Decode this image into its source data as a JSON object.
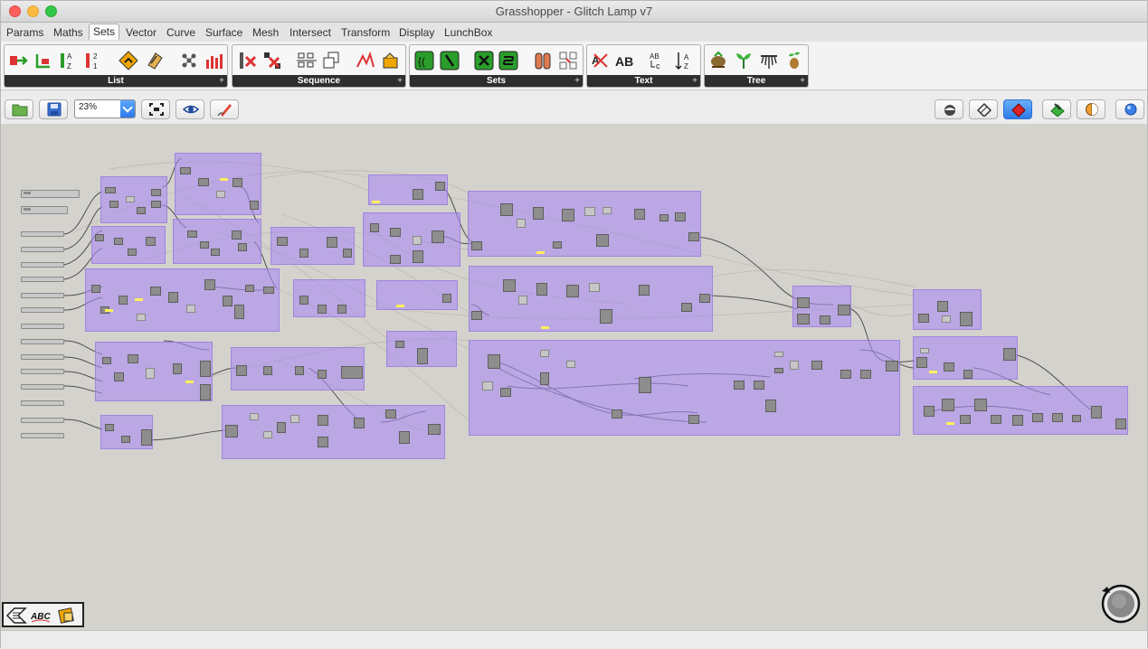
{
  "window": {
    "title": "Grasshopper - Glitch Lamp v7"
  },
  "tabs": [
    {
      "label": "Params",
      "active": false
    },
    {
      "label": "Maths",
      "active": false
    },
    {
      "label": "Sets",
      "active": true
    },
    {
      "label": "Vector",
      "active": false
    },
    {
      "label": "Curve",
      "active": false
    },
    {
      "label": "Surface",
      "active": false
    },
    {
      "label": "Mesh",
      "active": false
    },
    {
      "label": "Intersect",
      "active": false
    },
    {
      "label": "Transform",
      "active": false
    },
    {
      "label": "Display",
      "active": false
    },
    {
      "label": "LunchBox",
      "active": false
    }
  ],
  "ribbon": {
    "groups": [
      {
        "label": "List",
        "icons": [
          "list-item-icon",
          "list-length-icon",
          "sort-list-icon",
          "reverse-list-icon",
          "shift-list-icon",
          "split-list-icon",
          "weave-icon",
          "partition-icon"
        ]
      },
      {
        "label": "Sequence",
        "icons": [
          "cull-index-icon",
          "cull-pattern-icon",
          "series-icon",
          "duplicate-icon",
          "random-icon",
          "jitter-icon"
        ]
      },
      {
        "label": "Sets",
        "icons": [
          "set-union-icon",
          "set-difference-icon",
          "set-intersection-icon",
          "set-majority-icon",
          "member-index-icon",
          "combinations-icon"
        ]
      },
      {
        "label": "Text",
        "icons": [
          "text-split-icon",
          "concatenate-icon",
          "text-case-icon",
          "sort-text-icon"
        ]
      },
      {
        "label": "Tree",
        "icons": [
          "flatten-tree-icon",
          "graft-tree-icon",
          "explode-tree-icon",
          "simplify-tree-icon"
        ]
      }
    ]
  },
  "toolbar": {
    "zoom": "23%"
  },
  "colors": {
    "group_fill": "#aa8cf0",
    "canvas": "#d4d2cc",
    "component": "#8d8d8d",
    "panel_highlight": "#ffef5c",
    "active_button": "#2e7be8"
  }
}
